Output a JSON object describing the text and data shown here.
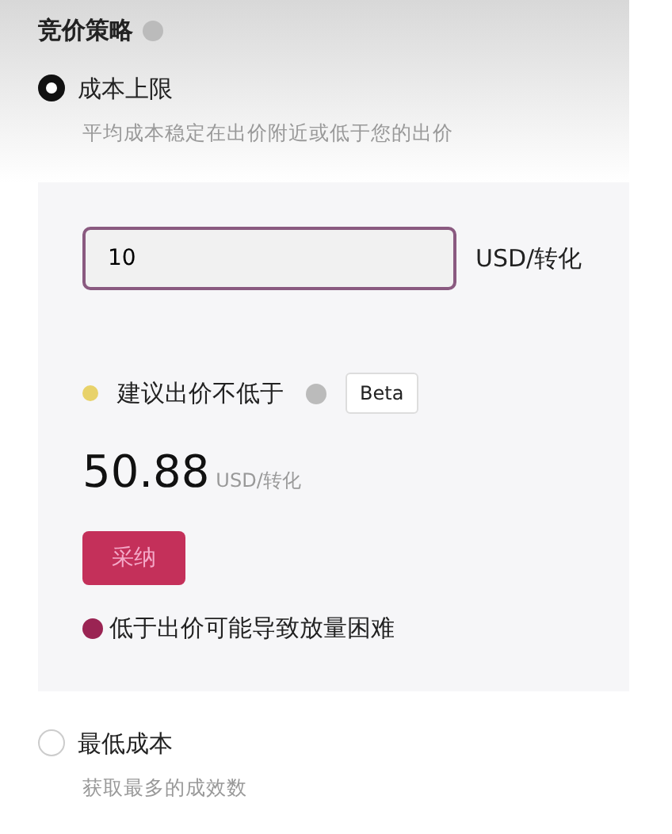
{
  "section": {
    "title": "竞价策略"
  },
  "options": [
    {
      "label": "成本上限",
      "description": "平均成本稳定在出价附近或低于您的出价",
      "selected": true,
      "panel": {
        "bid_field": {
          "value": "10",
          "unit": "USD/转化"
        },
        "suggestion": {
          "label": "建议出价不低于",
          "badge": "Beta",
          "value": "50.88",
          "unit": "USD/转化"
        },
        "button": "采纳",
        "warning": "低于出价可能导致放量困难"
      }
    },
    {
      "label": "最低成本",
      "description": "获取最多的成效数",
      "selected": false
    }
  ]
}
